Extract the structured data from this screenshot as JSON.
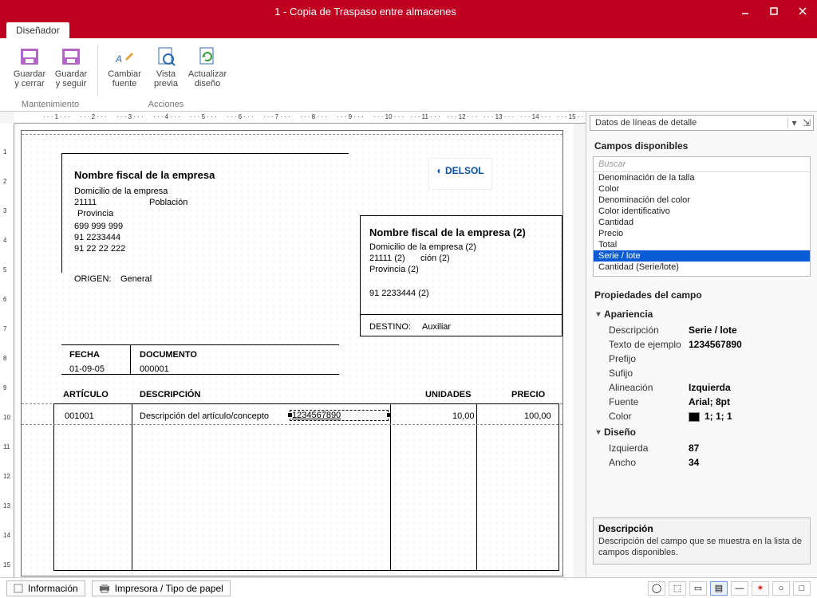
{
  "window": {
    "title": "1 - Copia de Traspaso entre almacenes"
  },
  "tab": {
    "label": "Diseñador"
  },
  "ribbon": {
    "maintenance_label": "Mantenimiento",
    "actions_label": "Acciones",
    "save_close": "Guardar\ny cerrar",
    "save_continue": "Guardar\ny seguir",
    "change_font": "Cambiar\nfuente",
    "preview": "Vista\nprevia",
    "refresh": "Actualizar\ndiseño"
  },
  "doc": {
    "company_name": "Nombre fiscal de la empresa",
    "company_addr": "Domicilio de la empresa",
    "zip": "21111",
    "city": "Población",
    "province": "Provincia",
    "phone1": "699 999 999",
    "phone2": "91 2233444",
    "phone3": "91 22 22 222",
    "origin_lbl": "ORIGEN:",
    "origin_val": "General",
    "company2_name": "Nombre fiscal de la empresa (2)",
    "company2_addr": "Domicilio de la empresa (2)",
    "zip2": "21111 (2)",
    "city2": "ción (2)",
    "province2": "Provincia (2)",
    "phone2_2": "91 2233444 (2)",
    "dest_lbl": "DESTINO:",
    "dest_val": "Auxiliar",
    "fecha_lbl": "FECHA",
    "doc_lbl": "DOCUMENTO",
    "fecha_val": "01-09-05",
    "doc_val": "000001",
    "col_art": "ARTÍCULO",
    "col_desc": "DESCRIPCIÓN",
    "col_units": "UNIDADES",
    "col_price": "PRECIO",
    "row_art": "001001",
    "row_desc": "Descripción del artículo/concepto",
    "row_serie": "1234567890",
    "row_units": "10,00",
    "row_price": "100,00",
    "logo": "DELSOL"
  },
  "side": {
    "combo": "Datos de líneas de detalle",
    "fields_title": "Campos disponibles",
    "search_ph": "Buscar",
    "fields": [
      "Denominación de la talla",
      "Color",
      "Denominación del color",
      "Color identificativo",
      "Cantidad",
      "Precio",
      "Total",
      "Serie / lote",
      "Cantidad (Serie/lote)"
    ],
    "selected_index": 7,
    "props_title": "Propiedades del campo",
    "group_appearance": "Apariencia",
    "group_design": "Diseño",
    "p_desc_k": "Descripción",
    "p_desc_v": "Serie / lote",
    "p_sample_k": "Texto de ejemplo",
    "p_sample_v": "1234567890",
    "p_prefix_k": "Prefijo",
    "p_prefix_v": "",
    "p_suffix_k": "Sufijo",
    "p_suffix_v": "",
    "p_align_k": "Alineación",
    "p_align_v": "Izquierda",
    "p_font_k": "Fuente",
    "p_font_v": "Arial; 8pt",
    "p_color_k": "Color",
    "p_color_v": "1; 1; 1",
    "p_left_k": "Izquierda",
    "p_left_v": "87",
    "p_width_k": "Ancho",
    "p_width_v": "34",
    "help_t": "Descripción",
    "help_d": "Descripción del campo que se muestra en la lista de campos disponibles."
  },
  "status": {
    "info": "Información",
    "printer": "Impresora / Tipo de papel"
  }
}
